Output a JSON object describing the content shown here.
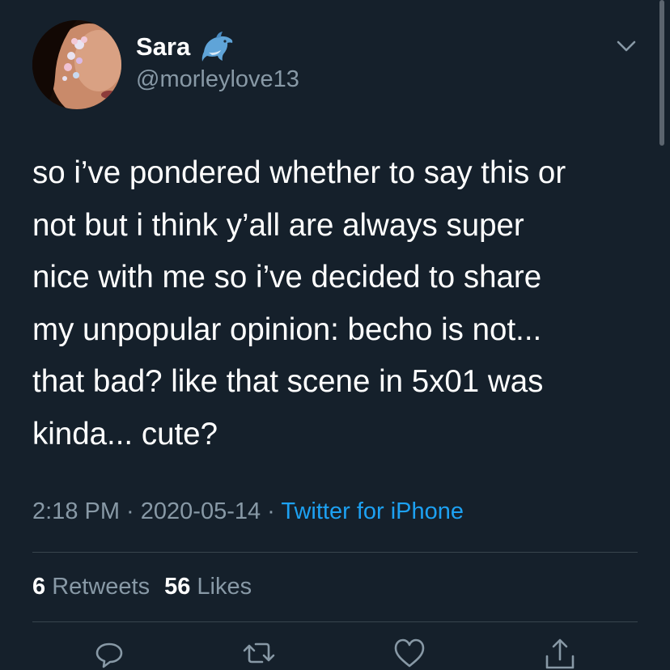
{
  "user": {
    "display_name": "Sara",
    "handle": "@morleylove13",
    "name_emoji_icon": "dolphin-icon",
    "avatar_icon": "face-with-flower-paint-avatar"
  },
  "tweet": {
    "lines": [
      "so i’ve pondered whether to say this or",
      "not but i think y’all are always super",
      "nice with me so i’ve decided to share",
      "my unpopular opinion: becho is not...",
      "that bad? like that scene in 5x01 was",
      "kinda... cute?"
    ]
  },
  "meta": {
    "time": "2:18 PM",
    "separator": " · ",
    "date": "2020-05-14",
    "source": "Twitter for iPhone"
  },
  "stats": {
    "retweets_count": "6",
    "retweets_label": "Retweets",
    "likes_count": "56",
    "likes_label": "Likes"
  },
  "actions": {
    "reply": "reply-icon",
    "retweet": "retweet-icon",
    "like": "heart-icon",
    "share": "share-icon"
  },
  "colors": {
    "background": "#15202b",
    "primary_text": "#ffffff",
    "secondary_text": "#8899a6",
    "link": "#1da1f2",
    "divider": "#38444d"
  }
}
